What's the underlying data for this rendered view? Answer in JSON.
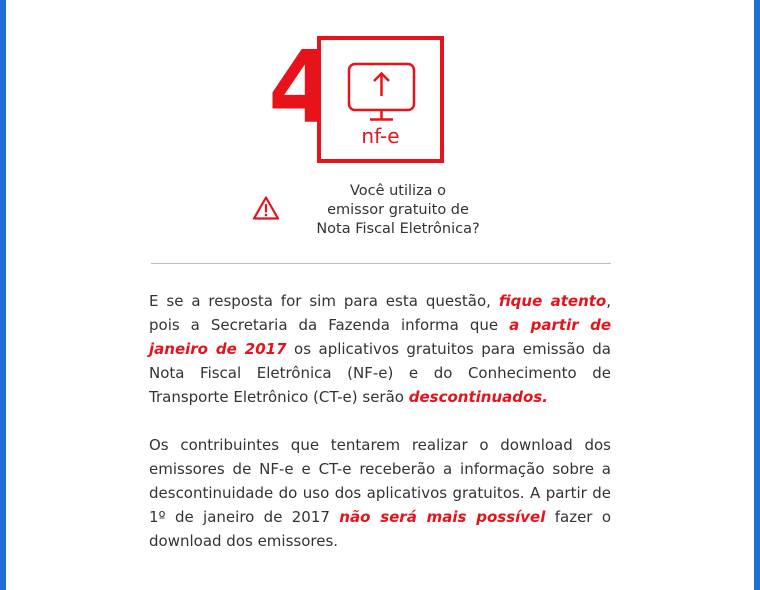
{
  "brand": {
    "accent": "#e8121a",
    "frame": "#1f6fd6"
  },
  "hero": {
    "number": "4",
    "logo_label": "nf-e",
    "logo_icon": "monitor-upload-icon"
  },
  "question": {
    "icon": "warning-icon",
    "line1": "Você utiliza o",
    "line2": "emissor gratuito de",
    "line3": "Nota Fiscal Eletrônica?"
  },
  "paragraph1": {
    "t1": "E se a resposta for sim para esta questão, ",
    "h1": "fique atento",
    "t2": ", pois a Secretaria da Fazenda informa que ",
    "h2": "a partir de janeiro de 2017",
    "t3": " os aplicativos gratuitos para emissão da Nota Fiscal Eletrônica (NF-e) e do Conhecimento de Transporte Eletrônico (CT-e) serão ",
    "h3": "descontinuados."
  },
  "paragraph2": {
    "t1": "Os contribuintes que tentarem realizar o download dos emissores de NF-e e CT-e receberão a informação sobre a descontinuidade do uso dos aplicativos gratuitos. A partir de 1º de janeiro de 2017 ",
    "h1": "não será mais possível",
    "t2": " fazer o download dos emissores."
  }
}
